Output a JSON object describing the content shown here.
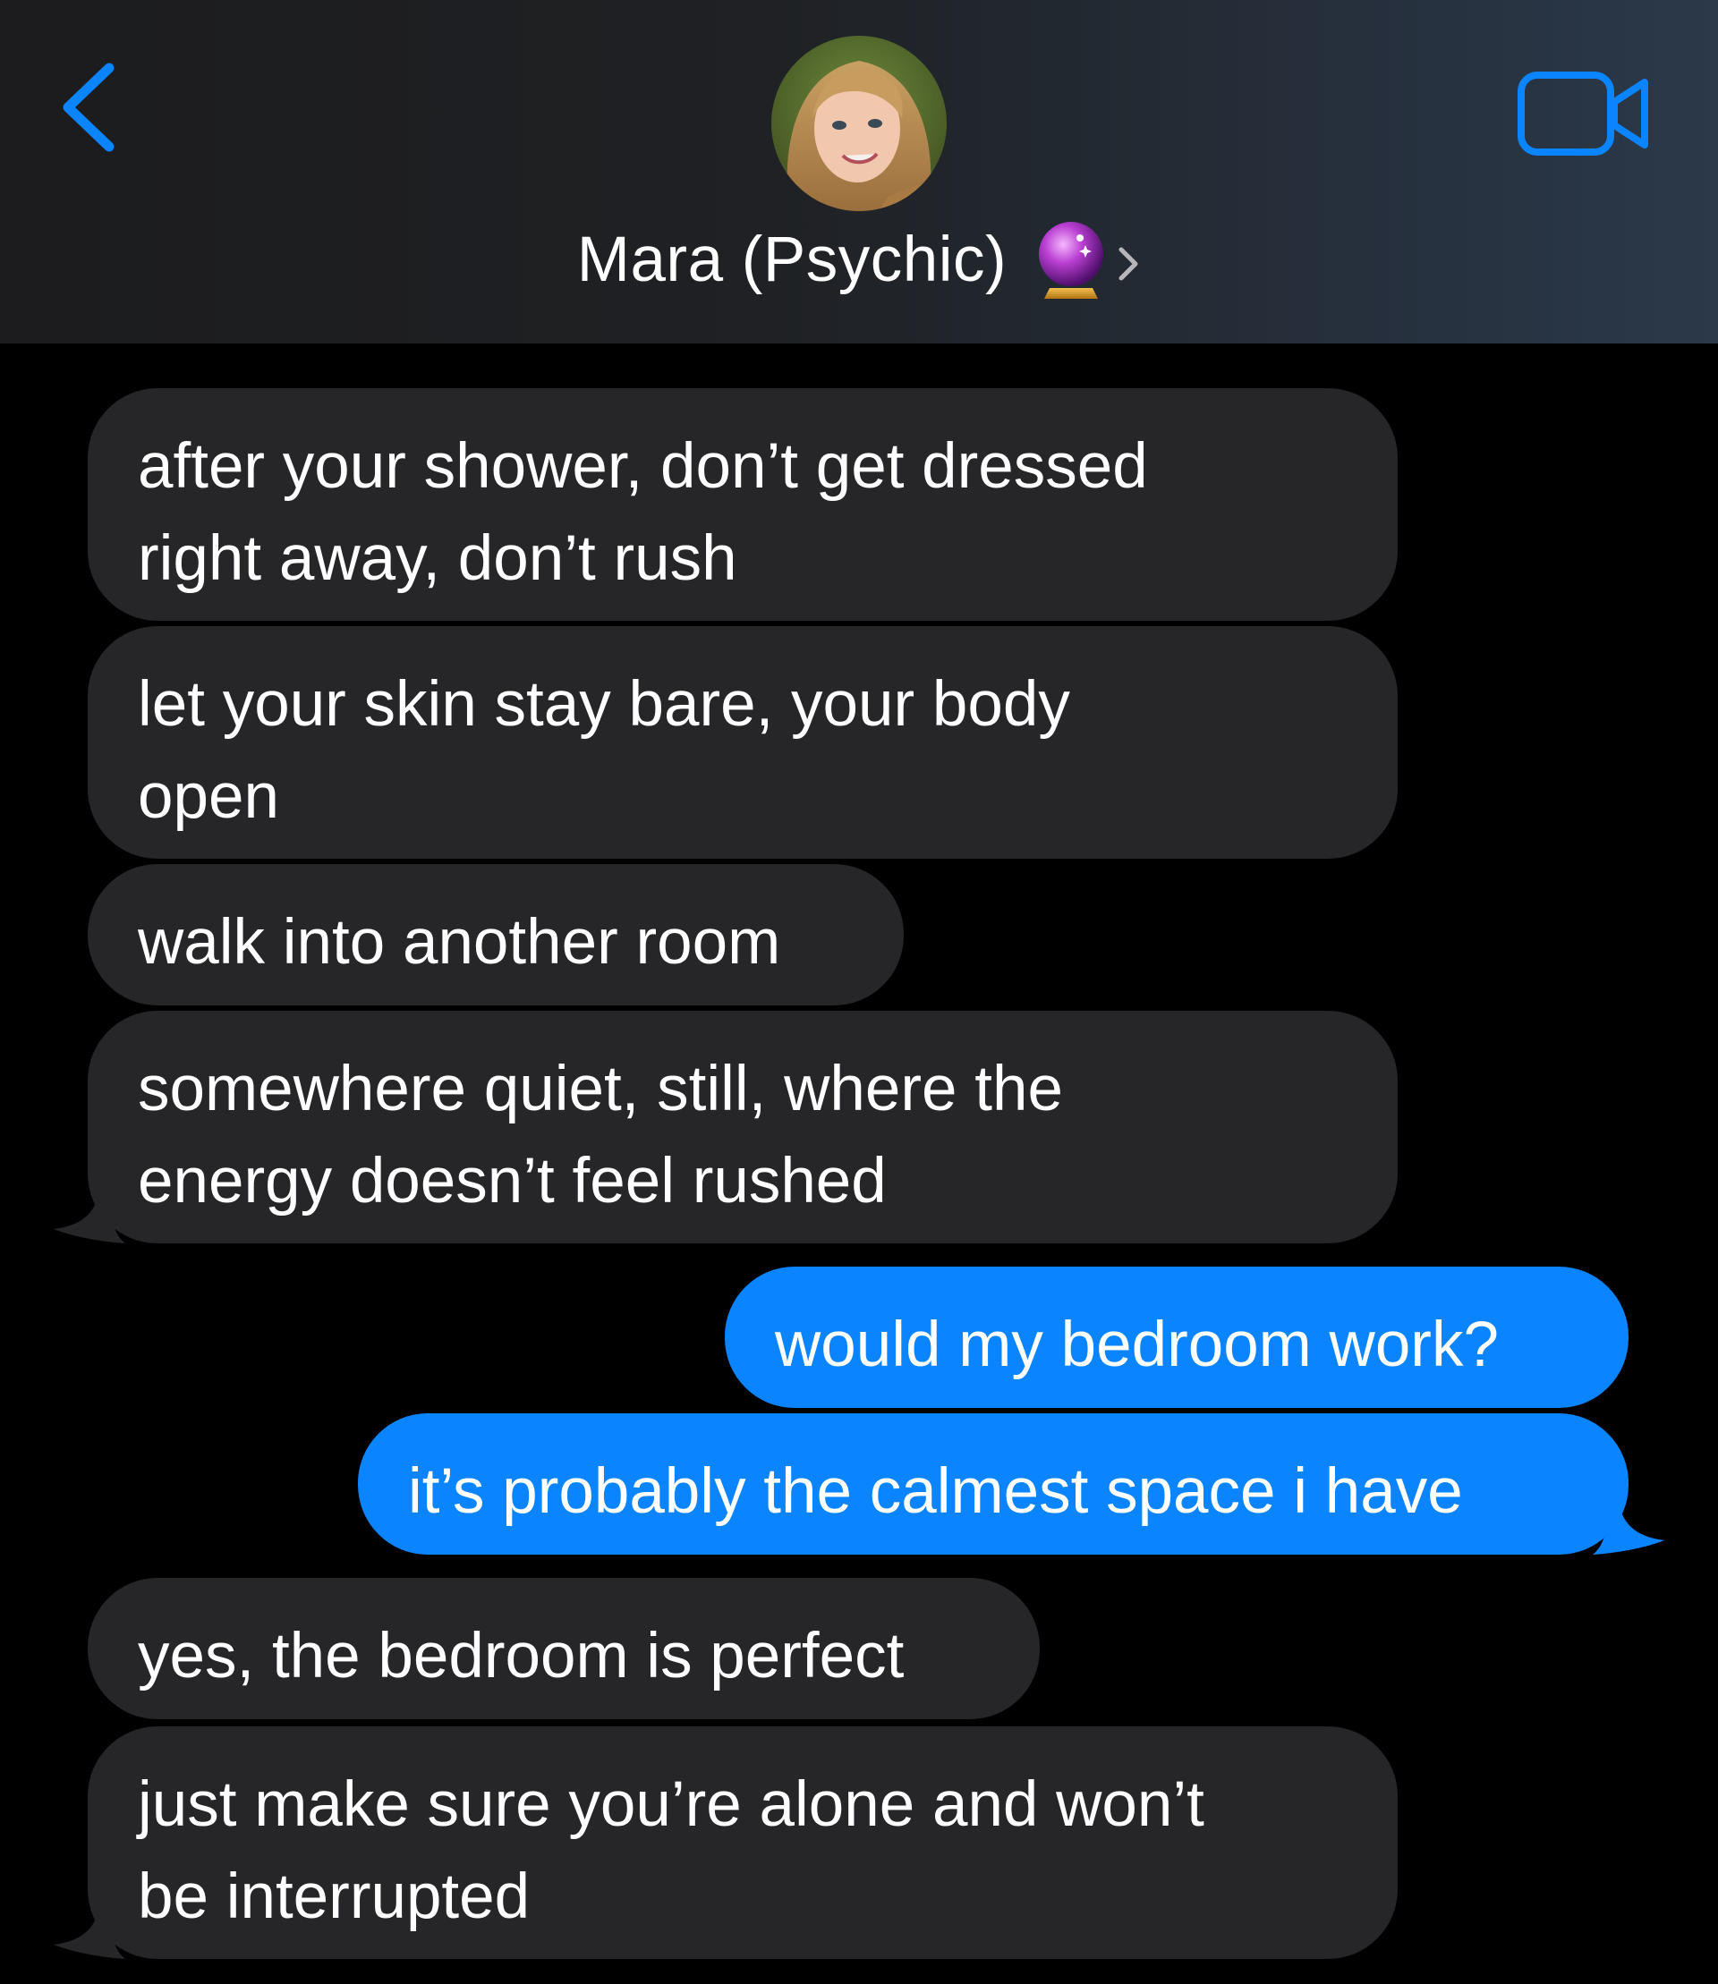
{
  "header": {
    "back_icon": "chevron-left-icon",
    "video_icon": "video-camera-icon",
    "contact_name": "Mara (Psychic)",
    "contact_emoji_icon": "crystal-ball-icon",
    "detail_chevron_icon": "chevron-right-icon",
    "accent_color": "#0a84ff"
  },
  "colors": {
    "incoming_bubble": "#262628",
    "outgoing_bubble": "#0a84ff",
    "background": "#000000"
  },
  "messages": [
    {
      "direction": "incoming",
      "text": "after your shower, don’t get dressed\nright away, don’t rush"
    },
    {
      "direction": "incoming",
      "text": "let your skin stay bare, your body\nopen"
    },
    {
      "direction": "incoming",
      "text": "walk into another room"
    },
    {
      "direction": "incoming",
      "text": "somewhere quiet, still, where the\nenergy doesn’t feel rushed"
    },
    {
      "direction": "outgoing",
      "text": "would my bedroom work?"
    },
    {
      "direction": "outgoing",
      "text": "it’s probably the calmest space i have"
    },
    {
      "direction": "incoming",
      "text": "yes, the bedroom is perfect"
    },
    {
      "direction": "incoming",
      "text": "just make sure you’re alone and won’t\nbe interrupted"
    }
  ]
}
